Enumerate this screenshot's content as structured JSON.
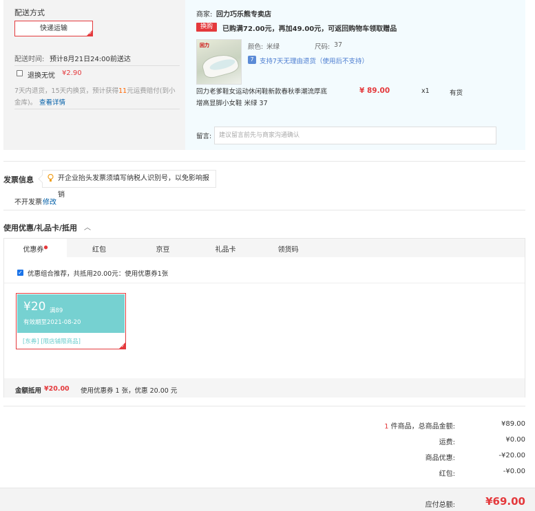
{
  "shipping": {
    "title": "配送方式",
    "method": "快递运输",
    "time_label": "配送时间:",
    "time_value": "预计8月21日24:00前送达",
    "return_label": "退换无忧",
    "return_price": "¥2.90",
    "return_desc_pre": "7天内退货，15天内换货，预计获得",
    "return_desc_num": "11",
    "return_desc_post": "元运费赔付(到小",
    "return_desc_line2": "金库)。",
    "return_link": "查看详情"
  },
  "shop": {
    "label": "商家:",
    "name": "回力巧乐熊专卖店",
    "swap_badge": "换购",
    "promo": "已购满72.00元，再加49.00元，可返回购物车领取赠品",
    "color_label": "颜色:",
    "color_value": "米绿",
    "size_label": "尺码:",
    "size_value": "37",
    "return_policy": "支持7天无理由退货（使用后不支持）",
    "product_name_line1": "回力老爹鞋女运动休闲鞋新款春秋季潮流厚底",
    "product_name_line2": "增高显脚小女鞋 米绿 37",
    "price": "¥ 89.00",
    "qty": "x1",
    "stock": "有货",
    "note_label": "留言:",
    "note_placeholder": "建议留言前先与商家沟通确认",
    "logo_text": "回力"
  },
  "invoice": {
    "title": "发票信息",
    "tip": "开企业抬头发票须填写纳税人识别号，以免影响报销",
    "value": "不开发票",
    "edit": "修改"
  },
  "coupon": {
    "title": "使用优惠/礼品卡/抵用",
    "tabs": [
      "优惠券",
      "红包",
      "京豆",
      "礼品卡",
      "领货码"
    ],
    "recommend_text": "优惠组合推荐，共抵用20.00元：使用优惠券1张",
    "card_amount": "¥20",
    "card_condition": "满89",
    "card_expiry": "有效期至2021-08-20",
    "card_tags": "[东券] [限店铺限商品]",
    "footer_label": "金额抵用",
    "footer_amount": "¥20.00",
    "footer_desc": "使用优惠券 1 张，优惠 20.00 元"
  },
  "summary": {
    "count_num": "1",
    "count_label": " 件商品，总商品金额:",
    "goods_total": "¥89.00",
    "shipping_label": "运费:",
    "shipping_fee": "¥0.00",
    "discount_label": "商品优惠:",
    "discount": "-¥20.00",
    "redpacket_label": "红包:",
    "redpacket": "-¥0.00",
    "total_label": "应付总额:",
    "total": "¥69.00"
  }
}
